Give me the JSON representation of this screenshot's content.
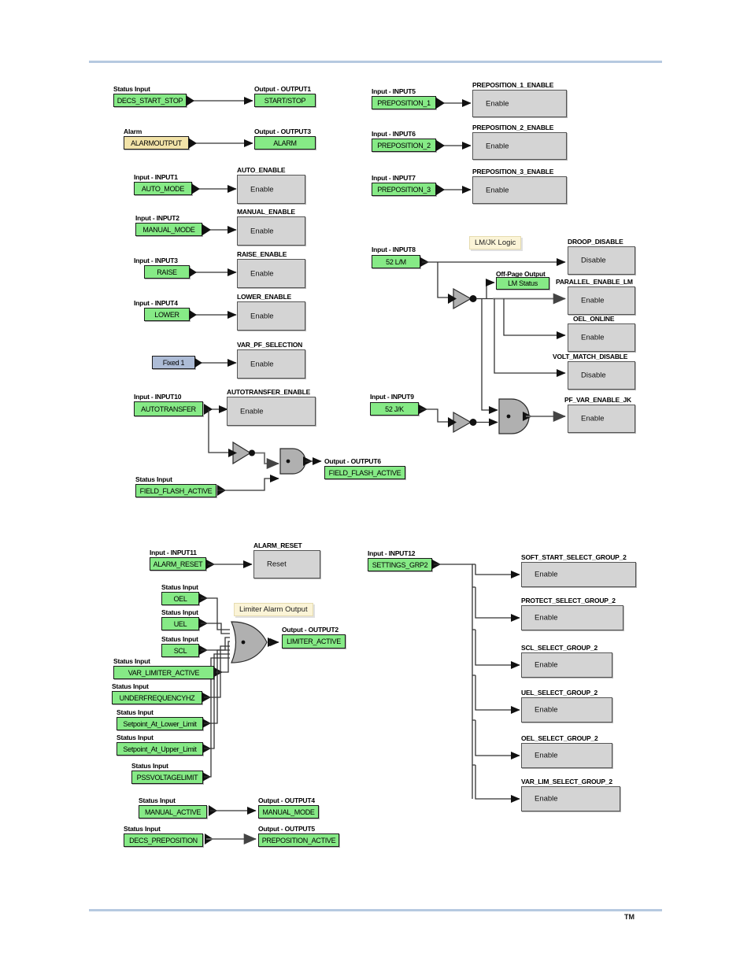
{
  "page": {
    "trademark": "TM",
    "colors": {
      "signal_green": "#86ea86",
      "signal_amber": "#f2e3a8",
      "signal_blue": "#adbcd6",
      "function_block_gray": "#d4d4d4",
      "note_yellow": "#fbf4d7",
      "rule_blue": "#b6c9e0",
      "gate_gray": "#b0b0b0"
    }
  },
  "notes": [
    {
      "id": "note-lmjk",
      "text": "LM/JK Logic"
    },
    {
      "id": "note-limiter",
      "text": "Limiter Alarm Output"
    }
  ],
  "column_left_top": [
    {
      "id": "decs-start-stop",
      "src_caption": "Status Input",
      "src_label": "DECS_START_STOP",
      "src_kind": "green",
      "dst_caption": "Output - OUTPUT1",
      "dst_label": "START/STOP",
      "dst_kind": "green"
    },
    {
      "id": "alarmoutput",
      "src_caption": "Alarm",
      "src_label": "ALARMOUTPUT",
      "src_kind": "amber",
      "dst_caption": "Output - OUTPUT3",
      "dst_label": "ALARM",
      "dst_kind": "green"
    },
    {
      "id": "auto-mode",
      "src_caption": "Input - INPUT1",
      "src_label": "AUTO_MODE",
      "src_kind": "green",
      "dst_caption": "AUTO_ENABLE",
      "dst_label": "Enable",
      "dst_kind": "block"
    },
    {
      "id": "manual-mode",
      "src_caption": "Input - INPUT2",
      "src_label": "MANUAL_MODE",
      "src_kind": "green",
      "dst_caption": "MANUAL_ENABLE",
      "dst_label": "Enable",
      "dst_kind": "block"
    },
    {
      "id": "raise",
      "src_caption": "Input - INPUT3",
      "src_label": "RAISE",
      "src_kind": "green",
      "dst_caption": "RAISE_ENABLE",
      "dst_label": "Enable",
      "dst_kind": "block"
    },
    {
      "id": "lower",
      "src_caption": "Input - INPUT4",
      "src_label": "LOWER",
      "src_kind": "green",
      "dst_caption": "LOWER_ENABLE",
      "dst_label": "Enable",
      "dst_kind": "block"
    },
    {
      "id": "fixed1",
      "src_caption": "",
      "src_label": "Fixed 1",
      "src_kind": "blue",
      "dst_caption": "VAR_PF_SELECTION",
      "dst_label": "Enable",
      "dst_kind": "block"
    },
    {
      "id": "autotransfer",
      "src_caption": "Input - INPUT10",
      "src_label": "AUTOTRANSFER",
      "src_kind": "green",
      "dst_caption": "AUTOTRANSFER_ENABLE",
      "dst_label": "Enable",
      "dst_kind": "block"
    }
  ],
  "field_flash": {
    "status_caption": "Status Input",
    "status_label": "FIELD_FLASH_ACTIVE",
    "out_caption": "Output - OUTPUT6",
    "out_label": "FIELD_FLASH_ACTIVE"
  },
  "column_right_top": [
    {
      "id": "preposition-1",
      "src_caption": "Input - INPUT5",
      "src_label": "PREPOSITION_1",
      "dst_caption": "PREPOSITION_1_ENABLE",
      "dst_label": "Enable"
    },
    {
      "id": "preposition-2",
      "src_caption": "Input - INPUT6",
      "src_label": "PREPOSITION_2",
      "dst_caption": "PREPOSITION_2_ENABLE",
      "dst_label": "Enable"
    },
    {
      "id": "preposition-3",
      "src_caption": "Input - INPUT7",
      "src_label": "PREPOSITION_3",
      "dst_caption": "PREPOSITION_3_ENABLE",
      "dst_label": "Enable"
    }
  ],
  "lmjk": {
    "input8_caption": "Input - INPUT8",
    "input8_label": "52 L/M",
    "input9_caption": "Input - INPUT9",
    "input9_label": "52 J/K",
    "offpage_caption": "Off-Page Output",
    "offpage_label": "LM Status",
    "outputs": [
      {
        "id": "droop-disable",
        "caption": "DROOP_DISABLE",
        "label": "Disable"
      },
      {
        "id": "parallel-enable-lm",
        "caption": "PARALLEL_ENABLE_LM",
        "label": "Enable"
      },
      {
        "id": "oel-online",
        "caption": "OEL_ONLINE",
        "label": "Enable"
      },
      {
        "id": "volt-match-disable",
        "caption": "VOLT_MATCH_DISABLE",
        "label": "Disable"
      },
      {
        "id": "pf-var-enable-jk",
        "caption": "PF_VAR_ENABLE_JK",
        "label": "Enable"
      }
    ]
  },
  "alarm_reset": {
    "src_caption": "Input - INPUT11",
    "src_label": "ALARM_RESET",
    "dst_caption": "ALARM_RESET",
    "dst_label": "Reset"
  },
  "limiter": {
    "inputs": [
      {
        "caption": "Status Input",
        "label": "OEL"
      },
      {
        "caption": "Status Input",
        "label": "UEL"
      },
      {
        "caption": "Status Input",
        "label": "SCL"
      },
      {
        "caption": "Status Input",
        "label": "VAR_LIMITER_ACTIVE"
      },
      {
        "caption": "Status Input",
        "label": "UNDERFREQUENCYHZ"
      },
      {
        "caption": "Status Input",
        "label": "Setpoint_At_Lower_Limit"
      },
      {
        "caption": "Status Input",
        "label": "Setpoint_At_Upper_Limit"
      },
      {
        "caption": "Status Input",
        "label": "PSSVOLTAGELIMIT"
      }
    ],
    "out_caption": "Output - OUTPUT2",
    "out_label": "LIMITER_ACTIVE"
  },
  "bottom_left_pairs": [
    {
      "id": "manual-active",
      "src_caption": "Status Input",
      "src_label": "MANUAL_ACTIVE",
      "dst_caption": "Output - OUTPUT4",
      "dst_label": "MANUAL_MODE"
    },
    {
      "id": "decs-preposition",
      "src_caption": "Status Input",
      "src_label": "DECS_PREPOSITION",
      "dst_caption": "Output - OUTPUT5",
      "dst_label": "PREPOSITION_ACTIVE"
    }
  ],
  "settings_group": {
    "src_caption": "Input - INPUT12",
    "src_label": "SETTINGS_GRP2",
    "outputs": [
      {
        "id": "soft-start-select-group-2",
        "caption": "SOFT_START_SELECT_GROUP_2",
        "label": "Enable"
      },
      {
        "id": "protect-select-group-2",
        "caption": "PROTECT_SELECT_GROUP_2",
        "label": "Enable"
      },
      {
        "id": "scl-select-group-2",
        "caption": "SCL_SELECT_GROUP_2",
        "label": "Enable"
      },
      {
        "id": "uel-select-group-2",
        "caption": "UEL_SELECT_GROUP_2",
        "label": "Enable"
      },
      {
        "id": "oel-select-group-2",
        "caption": "OEL_SELECT_GROUP_2",
        "label": "Enable"
      },
      {
        "id": "var-lim-select-group-2",
        "caption": "VAR_LIM_SELECT_GROUP_2",
        "label": "Enable"
      }
    ]
  }
}
